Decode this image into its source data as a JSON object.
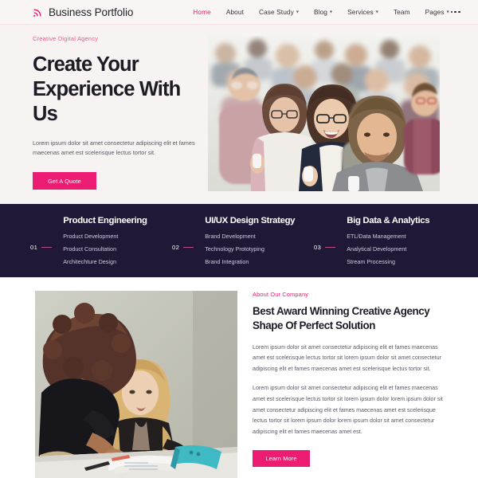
{
  "colors": {
    "accent": "#ec1c72",
    "accent_soft": "#ec5a8c",
    "dark_band": "#1f1937",
    "hero_bg": "#f7f3f2",
    "header_bg": "#faf5f5",
    "body_text": "#5a5663",
    "heading": "#1d1b24"
  },
  "header": {
    "brand_icon": "rss-signal-icon",
    "brand_name": "Business Portfolio",
    "nav": [
      {
        "label": "Home",
        "active": true,
        "caret": ""
      },
      {
        "label": "About",
        "active": false,
        "caret": ""
      },
      {
        "label": "Case Study",
        "active": false,
        "caret": "▾"
      },
      {
        "label": "Blog",
        "active": false,
        "caret": "▾"
      },
      {
        "label": "Services",
        "active": false,
        "caret": "▾"
      },
      {
        "label": "Team",
        "active": false,
        "caret": ""
      },
      {
        "label": "Pages",
        "active": false,
        "caret": "▾"
      }
    ],
    "more_menu_icon": "three-dots-icon"
  },
  "hero": {
    "eyebrow": "Creative Digital Agency",
    "title_line1": "Create Your",
    "title_line2": "Experience With Us",
    "description": "Lorem ipsum dolor sit amet consectetur adipiscing elit et fames maecenas amet est scelerisque lectus tortor sit.",
    "cta_label": "Get A Quote",
    "image_alt": "conference-audience-photo"
  },
  "services": {
    "columns": [
      {
        "number": "01",
        "title": "Product Engineering",
        "links": [
          "Product Development",
          "Product Consultation",
          "Architechture Design"
        ]
      },
      {
        "number": "02",
        "title": "UI/UX Design Strategy",
        "links": [
          "Brand Development",
          "Technology Prototyping",
          "Brand Integration"
        ]
      },
      {
        "number": "03",
        "title": "Big Data & Analytics",
        "links": [
          "ETL/Data Management",
          "Analytical Development",
          "Stream Processing"
        ]
      }
    ]
  },
  "about": {
    "image_alt": "two-women-meeting-at-desk-photo",
    "eyebrow": "About Our Company",
    "title": "Best Award Winning Creative Agency Shape Of Perfect Solution",
    "paragraph1": "Lorem ipsum dolor sit amet consectetur adipiscing elit et fames maecenas amet est scelerisque lectus tortor sit lorem ipsum dolor sit amet consectetur adipiscing elit et fames maecenas amet est scelerisque lectus tortor sit.",
    "paragraph2": "Lorem ipsum dolor sit amet consectetur adipiscing elit et fames maecenas amet est scelerisque lectus tortor sit lorem ipsum dolor lorem ipsum dolor sit amet consectetur adipiscing elit et fames maecenas amet est scelerisque lectus tortor sit lorem ipsum dolor lorem ipsum dolor sit amet consectetur adipiscing elit et fames maecenas amet est.",
    "cta_label": "Learn More"
  }
}
